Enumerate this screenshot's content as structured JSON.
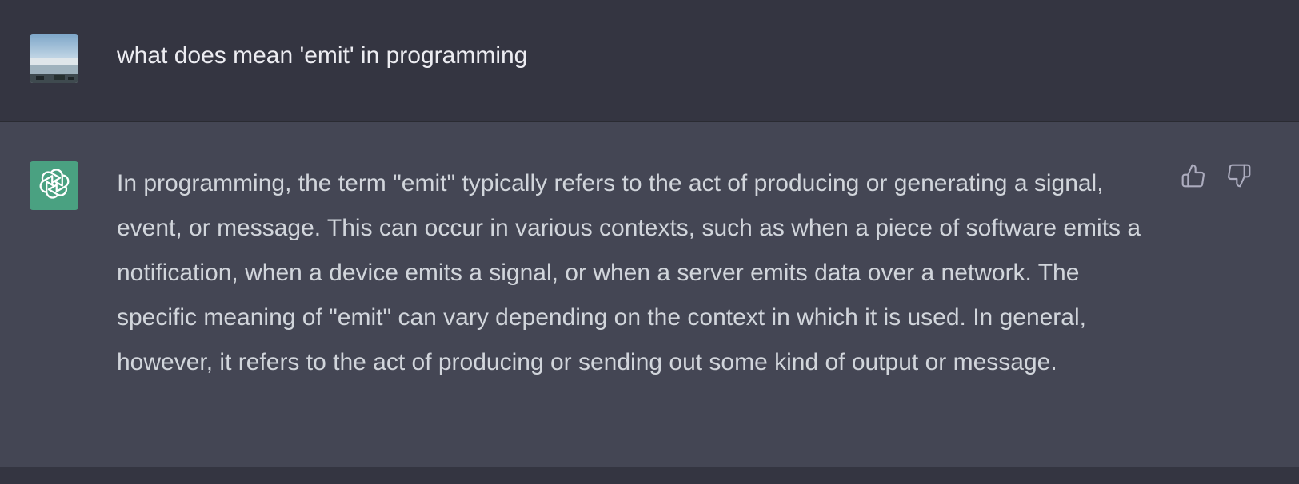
{
  "conversation": {
    "user_message": "what does mean 'emit' in programming",
    "assistant_message": "In programming, the term \"emit\" typically refers to the act of producing or generating a signal, event, or message. This can occur in various contexts, such as when a piece of software emits a notification, when a device emits a signal, or when a server emits data over a network. The specific meaning of \"emit\" can vary depending on the context in which it is used. In general, however, it refers to the act of producing or sending out some kind of output or message."
  },
  "icons": {
    "user_avatar": "user-avatar-photo",
    "assistant_avatar": "openai-logo-icon",
    "thumbs_up": "thumbs-up-icon",
    "thumbs_down": "thumbs-down-icon"
  },
  "colors": {
    "user_row_bg": "#343541",
    "assistant_row_bg": "#444654",
    "assistant_avatar_bg": "#4aa181",
    "user_text": "#ececf1",
    "assistant_text": "#d1d5db",
    "icon_gray": "#acacbe"
  }
}
